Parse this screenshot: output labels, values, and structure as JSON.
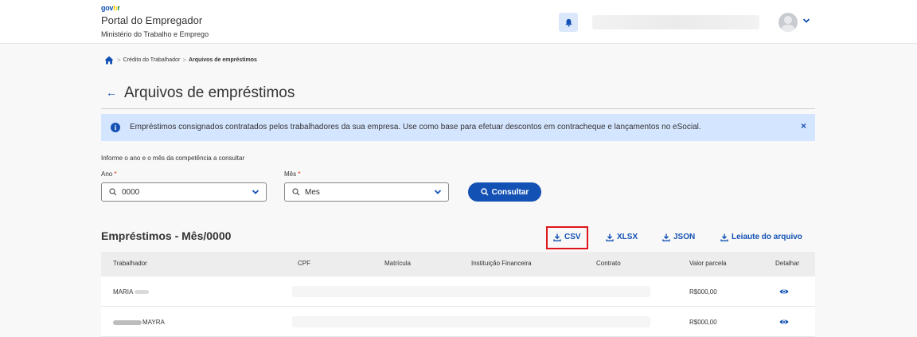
{
  "header": {
    "brand": {
      "g": "g",
      "ov": "ov",
      "b": "b",
      "r": "r"
    },
    "title": "Portal do Empregador",
    "subtitle": "Ministério do Trabalho e Emprego"
  },
  "breadcrumb": {
    "items": [
      "Crédito do Trabalhador",
      "Arquivos de empréstimos"
    ],
    "separator": ">"
  },
  "page": {
    "back": "←",
    "title": "Arquivos de empréstimos"
  },
  "alert": {
    "message": "Empréstimos consignados contratados pelos trabalhadores da sua empresa. Use como base para efetuar descontos em contracheque e lançamentos no eSocial.",
    "info_glyph": "i",
    "close_glyph": "×"
  },
  "form": {
    "hint": "Informe o ano e o mês da competência a consultar",
    "ano": {
      "label": "Ano",
      "required": "*",
      "value": "0000"
    },
    "mes": {
      "label": "Mês",
      "required": "*",
      "value": "Mes"
    },
    "submit": "Consultar"
  },
  "section": {
    "title": "Empréstimos - Mês/0000",
    "downloads": [
      "CSV",
      "XLSX",
      "JSON",
      "Leiaute do arquivo"
    ]
  },
  "table": {
    "columns": [
      "Trabalhador",
      "CPF",
      "Matrícula",
      "Instituição Financeira",
      "Contrato",
      "Valor parcela",
      "Detalhar"
    ],
    "rows": [
      {
        "trabalhador": "MARIA",
        "valor": "R$000,00"
      },
      {
        "trabalhador": "MAYRA",
        "valor": "R$000,00"
      }
    ]
  },
  "colors": {
    "primary": "#1351b4",
    "alert_bg": "#d4e5ff",
    "highlight": "#e0151b"
  },
  "icons": [
    "home-icon",
    "bell-icon",
    "chevron-down-icon",
    "info-icon",
    "close-icon",
    "search-icon",
    "download-icon",
    "eye-icon",
    "back-arrow-icon"
  ]
}
